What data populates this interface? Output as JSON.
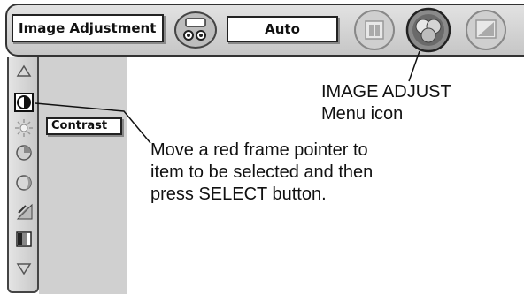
{
  "menu_bar": {
    "title": "Image Adjustment",
    "mode": "Auto",
    "icons": [
      "computer-input-icon",
      "image-select-icon",
      "image-adjust-icon",
      "screen-icon"
    ]
  },
  "side_menu": {
    "icons": [
      "scroll-up-icon",
      "contrast-icon",
      "brightness-icon",
      "color-icon",
      "tint-icon",
      "sharpness-icon",
      "gamma-icon",
      "scroll-down-icon"
    ],
    "selected_tooltip": "Contrast"
  },
  "annotations": {
    "icon_note": [
      "IMAGE ADJUST",
      "Menu icon"
    ],
    "pointer_note": [
      "Move a red frame pointer to",
      "item to be selected and then",
      "press SELECT button."
    ]
  }
}
